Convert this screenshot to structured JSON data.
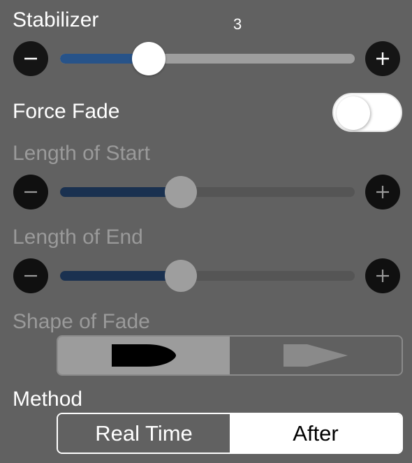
{
  "stabilizer": {
    "label": "Stabilizer",
    "value_text": "3",
    "level": 0.3,
    "minus_icon": "minus-icon",
    "plus_icon": "plus-icon"
  },
  "force_fade": {
    "label": "Force Fade",
    "enabled": false
  },
  "length_of_start": {
    "label": "Length of Start",
    "level": 0.41,
    "enabled": false
  },
  "length_of_end": {
    "label": "Length of End",
    "level": 0.41,
    "enabled": false
  },
  "shape_of_fade": {
    "label": "Shape of Fade",
    "options": [
      "rounded-tip-shape-icon",
      "pointed-tip-shape-icon"
    ],
    "selected_index": 0
  },
  "method": {
    "label": "Method",
    "options": [
      "Real Time",
      "After"
    ],
    "selected": "After"
  },
  "colors": {
    "panel_bg": "#616161",
    "slider_fill": "#275389",
    "slider_fill_disabled": "#1a3150"
  }
}
